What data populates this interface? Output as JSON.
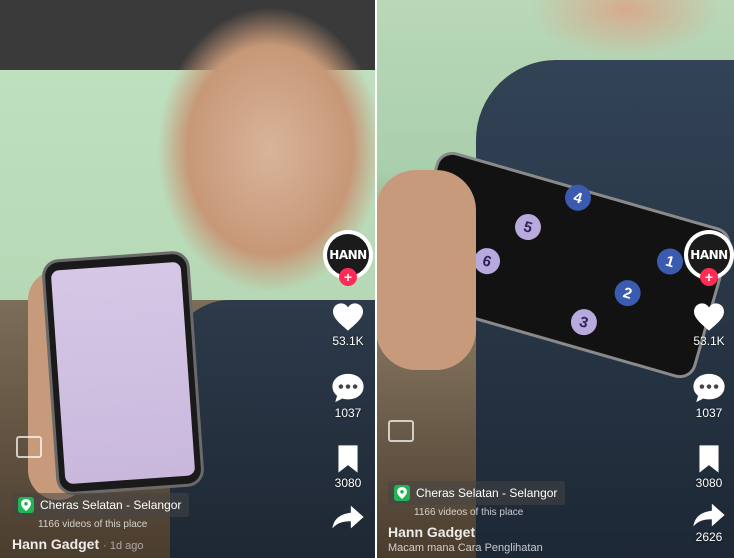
{
  "panels": [
    {
      "creator_avatar_text": "HANN",
      "likes": "53.1K",
      "comments": "1037",
      "saves": "3080",
      "location": "Cheras Selatan - Selangor",
      "location_sub": "1166 videos of this place",
      "author": "Hann Gadget",
      "ago": "· 1d ago"
    },
    {
      "creator_avatar_text": "HANN",
      "likes": "53.1K",
      "comments": "1037",
      "saves": "3080",
      "shares": "2626",
      "location": "Cheras Selatan - Selangor",
      "location_sub": "1166 videos of this place",
      "author": "Hann Gadget",
      "caption": "Macam mana Cara Penglihatan",
      "keypad": [
        "4",
        "5",
        "6",
        "1",
        "2",
        "3"
      ]
    }
  ],
  "colors": {
    "accent_red": "#fe2c55",
    "location_green": "#20b455",
    "key_blue": "#3b5bb0",
    "key_lilac": "#b8aadd"
  }
}
